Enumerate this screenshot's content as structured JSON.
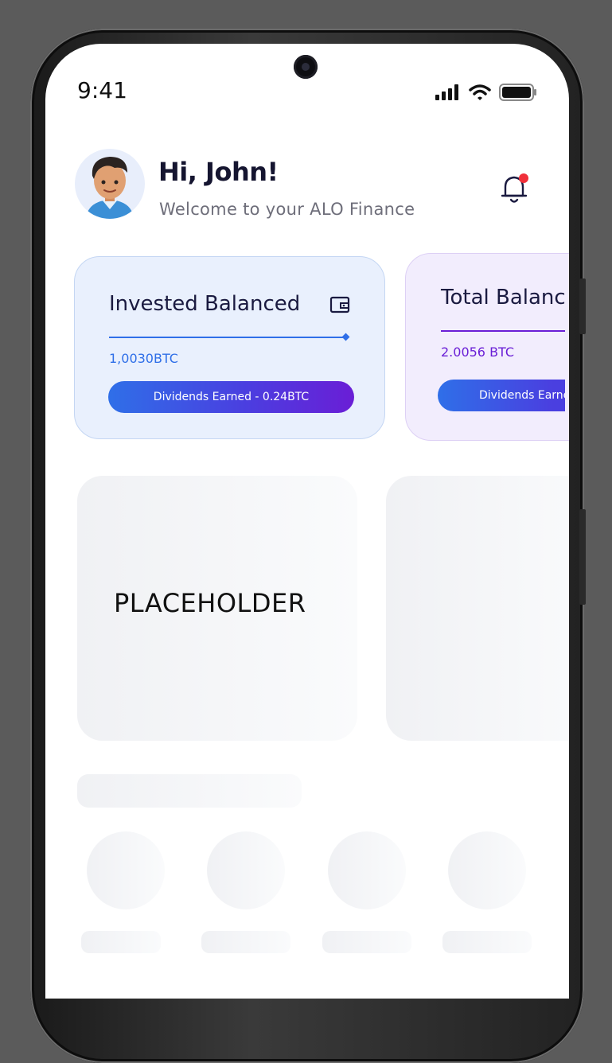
{
  "status_bar": {
    "time": "9:41"
  },
  "header": {
    "greeting": "Hi, John!",
    "subtitle": "Welcome to your ALO Finance"
  },
  "cards": [
    {
      "title": "Invested Balanced",
      "amount": "1,0030BTC",
      "pill": "Dividends Earned - 0.24BTC",
      "icon": "wallet-icon",
      "accent": "#2f6fe8"
    },
    {
      "title": "Total Balanced",
      "amount": "2.0056 BTC",
      "pill": "Dividends Earned",
      "accent": "#6a1ed6"
    }
  ],
  "placeholder": {
    "label": "PLACEHOLDER"
  },
  "colors": {
    "brand_blue": "#2f6fe8",
    "brand_purple": "#6a1ed6",
    "notification": "#f0303a"
  }
}
